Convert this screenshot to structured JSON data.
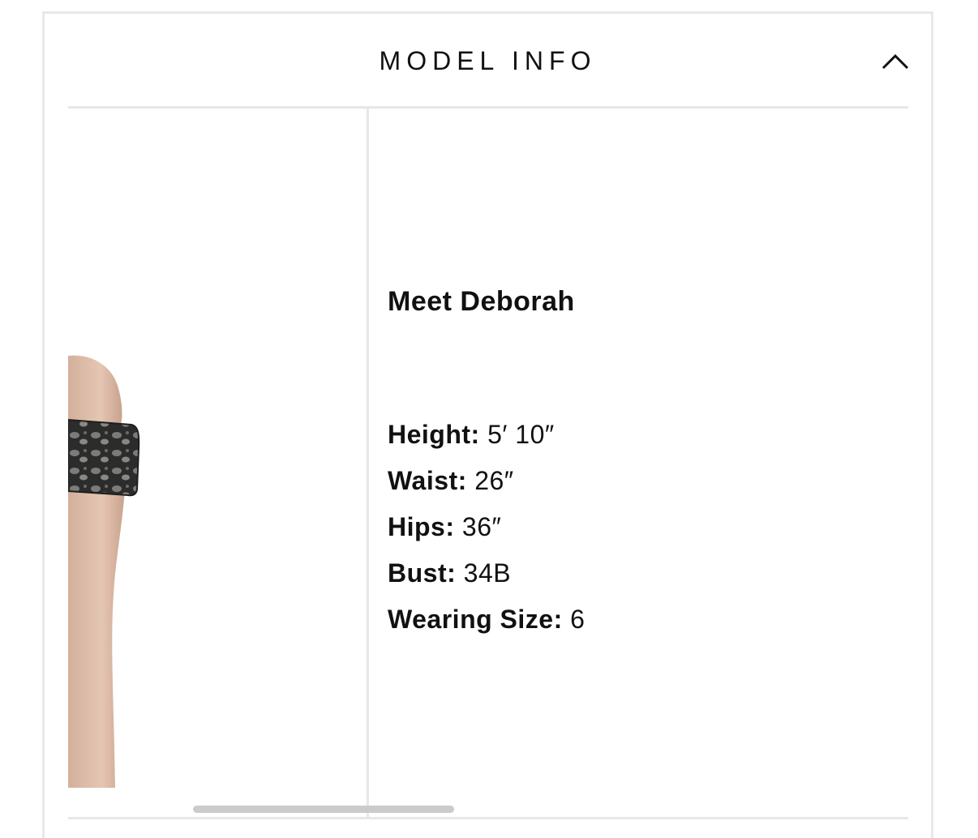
{
  "section": {
    "title": "MODEL INFO",
    "toggle_icon": "chevron-up-icon",
    "expanded": true
  },
  "model": {
    "heading": "Meet Deborah",
    "stats": [
      {
        "label": "Height:",
        "value": "5′ 10″"
      },
      {
        "label": "Waist:",
        "value": "26″"
      },
      {
        "label": "Hips:",
        "value": "36″"
      },
      {
        "label": "Bust:",
        "value": "34B"
      },
      {
        "label": "Wearing Size:",
        "value": "6"
      }
    ]
  },
  "photo": {
    "subject": "model-arm-lace-sleeve"
  },
  "colors": {
    "border": "#e8e8e6",
    "text": "#111111",
    "scrollbar": "#cbcbcb"
  }
}
